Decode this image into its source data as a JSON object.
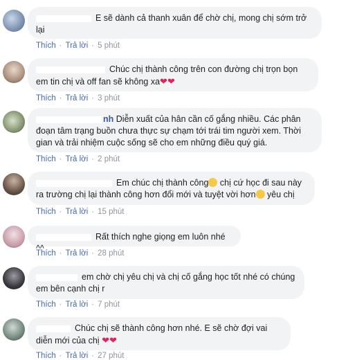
{
  "comments": [
    {
      "text": "E sẽ dành cả thanh xuân để chờ chị, mong chị sớm trở lại",
      "like": "Thích",
      "reply": "Trả lời",
      "time": "5 phút"
    },
    {
      "text": "Chúc chị thành công trên con đường chị trọn bọn em tin chị và off fan sẽ không xa",
      "like": "Thích",
      "reply": "Trả lời",
      "time": "3 phút"
    },
    {
      "name_fragment": "nh",
      "text": "Diễn xuất của hân cần cố gắng nhiều. Các phân đoạn tâm trạng buồn chưa thực sự chạm tới trái tim người xem. Thời gian và trải nhiệm cuộc sống sẽ cho em những điều quý giá.",
      "like": "Thích",
      "reply": "Trả lời",
      "time": "2 phút"
    },
    {
      "text_a": "Em chúc chị thành công",
      "text_b": "chị cứ học đi sau này ra trường chị lại thành công hơn đổi mới và tuyệt vời hơn",
      "text_c": "yêu chị",
      "like": "Thích",
      "reply": "Trả lời",
      "time": "15 phút"
    },
    {
      "text": "Rất thích nghe giọng em luôn nhé ^^",
      "like": "Thích",
      "reply": "Trả lời",
      "time": "28 phút"
    },
    {
      "text": "em chờ chị yêu chị và chị cố gắng học tốt nhé có chúng em bên cạnh chị r",
      "like": "Thích",
      "reply": "Trả lời",
      "time": "7 phút"
    },
    {
      "text": "Chúc chị sẽ thành công hơn nhé. E sẽ chờ đợi vai diễn mới của chị",
      "like": "Thích",
      "reply": "Trả lời",
      "time": "27 phút"
    }
  ],
  "icons": {
    "heart": "red-heart-emoji",
    "smile": "smiling-face-emoji"
  },
  "colors": {
    "bubble": "#f2f3f5",
    "link": "#4267b2",
    "meta": "#90949c",
    "heart": "#e0245e"
  }
}
